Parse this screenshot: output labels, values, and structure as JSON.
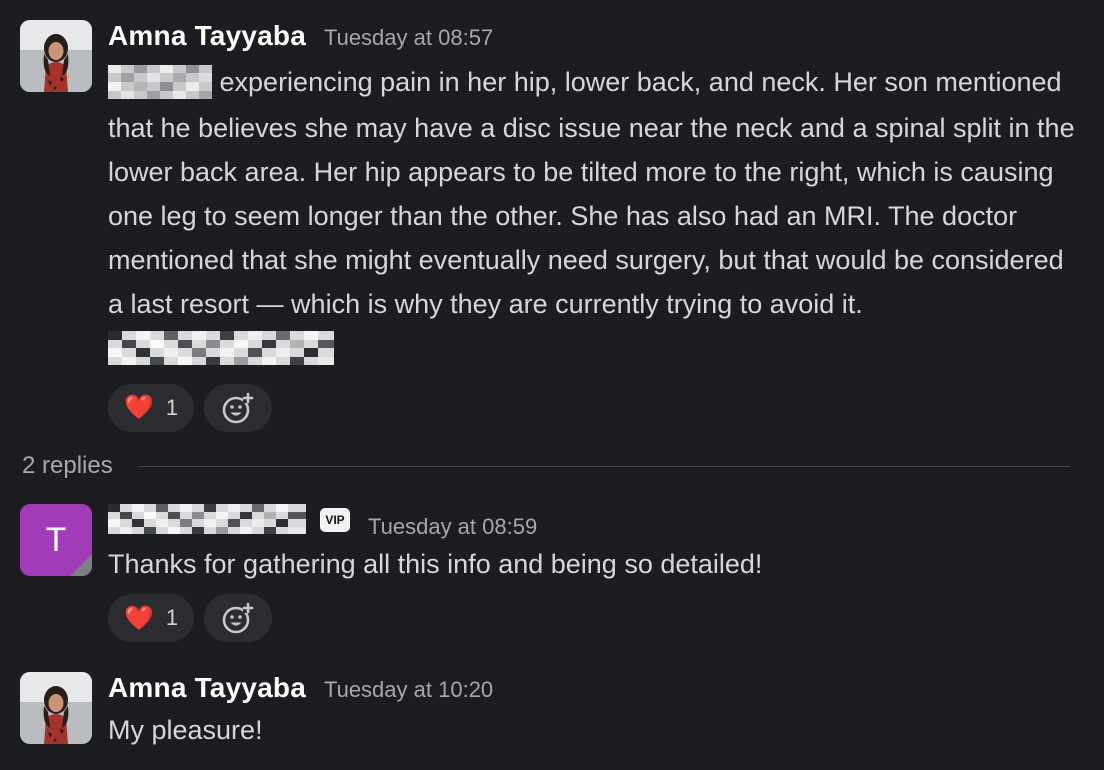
{
  "messages": [
    {
      "author": "Amna Tayyaba",
      "time": "Tuesday at 08:57",
      "text": "experiencing pain in her hip, lower back, and neck. Her son mentioned that he believes she may have a disc issue near the neck and a spinal split in the lower back area. Her hip appears to be tilted more to the right, which is causing one leg to seem longer than the other. She has also had an MRI. The doctor mentioned that she might eventually need surgery, but that would be considered a last resort — which is why they are currently trying to avoid it.",
      "reactions": [
        {
          "emoji": "❤️",
          "count": "1"
        }
      ]
    }
  ],
  "replies": {
    "label": "2 replies",
    "items": [
      {
        "avatar_letter": "T",
        "badge": "VIP",
        "time": "Tuesday at 08:59",
        "text": "Thanks for gathering all this info and being so detailed!",
        "reactions": [
          {
            "emoji": "❤️",
            "count": "1"
          }
        ]
      },
      {
        "author": "Amna Tayyaba",
        "time": "Tuesday at 10:20",
        "text": "My pleasure!"
      }
    ]
  },
  "colors": {
    "background": "#1c1d21",
    "reaction_bg": "#2c2d31",
    "avatar_purple": "#a23bb8",
    "heart": "#e8202f"
  },
  "icons": [
    "add-reaction-icon",
    "heart-icon"
  ]
}
